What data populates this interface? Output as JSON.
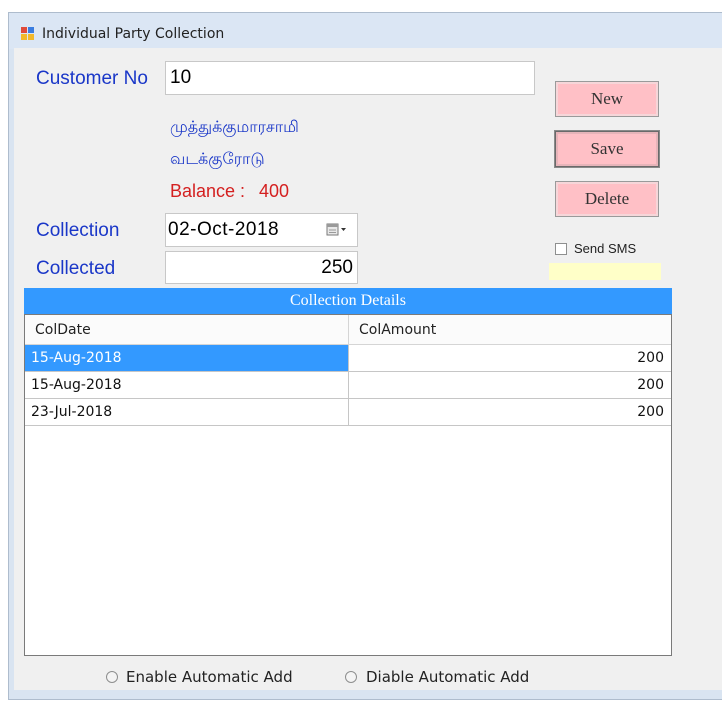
{
  "window": {
    "title": "Individual Party Collection"
  },
  "form": {
    "customer_no_label": "Customer No",
    "customer_no_value": "10",
    "customer_name": "முத்துக்குமாரசாமி",
    "customer_address": "வடக்குரோடு",
    "balance_label": "Balance :",
    "balance_value": "400",
    "collection_label": "Collection",
    "collection_date": "02-Oct-2018",
    "collected_label": "Collected",
    "collected_value": "250"
  },
  "buttons": {
    "new": "New",
    "save": "Save",
    "delete": "Delete"
  },
  "send_sms": {
    "label": "Send SMS",
    "checked": false
  },
  "grid": {
    "title": "Collection Details",
    "columns": [
      "ColDate",
      "ColAmount"
    ],
    "rows": [
      {
        "date": "15-Aug-2018",
        "amount": "200",
        "selected": true
      },
      {
        "date": "15-Aug-2018",
        "amount": "200",
        "selected": false
      },
      {
        "date": "23-Jul-2018",
        "amount": "200",
        "selected": false
      }
    ]
  },
  "options": {
    "enable_auto_add": "Enable Automatic Add",
    "disable_auto_add": "Diable Automatic Add"
  },
  "colors": {
    "accent": "#3399ff",
    "button_bg": "#ffc0c6",
    "label_blue": "#1a37c8",
    "balance_red": "#d42020"
  }
}
